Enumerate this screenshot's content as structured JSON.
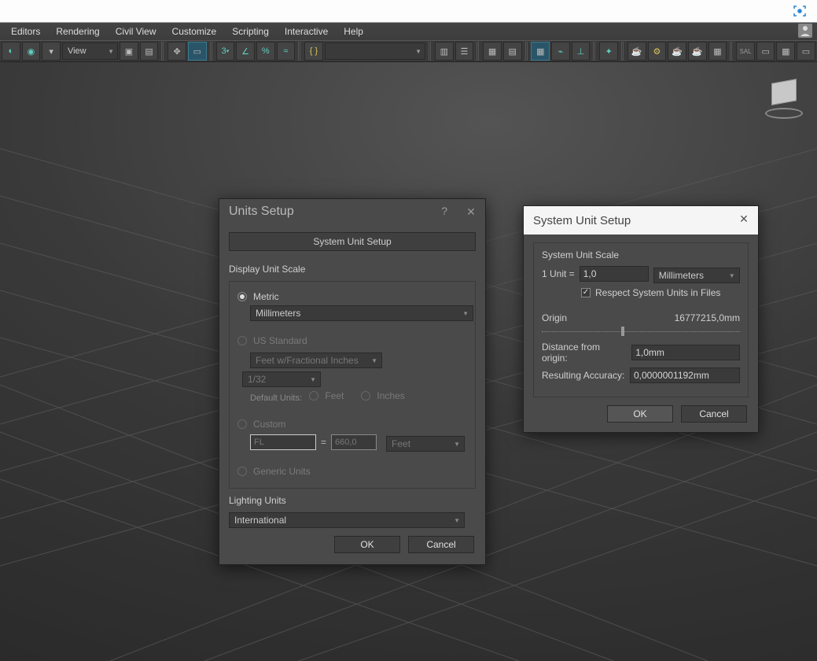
{
  "menu": {
    "items": [
      "Editors",
      "Rendering",
      "Civil View",
      "Customize",
      "Scripting",
      "Interactive",
      "Help"
    ]
  },
  "toolbar": {
    "view_selector": "View"
  },
  "dialogs": {
    "units": {
      "title": "Units Setup",
      "help": "?",
      "sys_btn": "System Unit Setup",
      "display_scale": "Display Unit Scale",
      "metric": "Metric",
      "metric_unit": "Millimeters",
      "us": "US Standard",
      "us_sel1": "Feet w/Fractional Inches",
      "us_sel2": "1/32",
      "default_units": "Default Units:",
      "feet": "Feet",
      "inches": "Inches",
      "custom": "Custom",
      "custom_left": "FL",
      "custom_eq": "=",
      "custom_right": "660,0",
      "custom_unit": "Feet",
      "generic": "Generic Units",
      "lighting": "Lighting Units",
      "lighting_sel": "International",
      "ok": "OK",
      "cancel": "Cancel"
    },
    "sys": {
      "title": "System Unit Setup",
      "scale_label": "System Unit Scale",
      "one_unit": "1 Unit =",
      "one_unit_val": "1,0",
      "unit_sel": "Millimeters",
      "respect": "Respect System Units in Files",
      "origin": "Origin",
      "origin_val": "16777215,0mm",
      "dist_label": "Distance from origin:",
      "dist_val": "1,0mm",
      "acc_label": "Resulting Accuracy:",
      "acc_val": "0,0000001192mm",
      "ok": "OK",
      "cancel": "Cancel"
    }
  }
}
